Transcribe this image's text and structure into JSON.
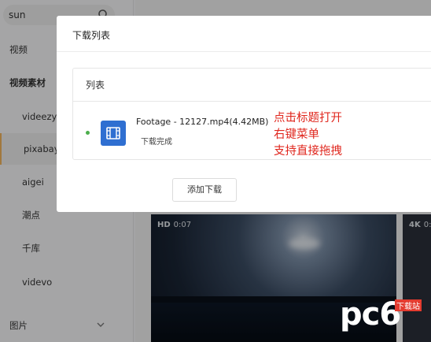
{
  "sidebar": {
    "search_value": "sun",
    "items": [
      {
        "label": "视频"
      },
      {
        "label": "视频素材"
      },
      {
        "label": "videezy"
      },
      {
        "label": "pixabay"
      },
      {
        "label": "aigei"
      },
      {
        "label": "潮点"
      },
      {
        "label": "千库"
      },
      {
        "label": "videvo"
      },
      {
        "label": "图片"
      }
    ]
  },
  "videos": [
    {
      "quality": "HD",
      "duration": "0:07"
    },
    {
      "quality": "4K",
      "duration": "0:0"
    }
  ],
  "dialog": {
    "title": "下载列表",
    "panel_title": "列表",
    "file": {
      "name": "Footage - 12127.mp4(4.42MB)",
      "status": "下载完成"
    },
    "annotation": [
      "点击标题打开",
      "右键菜单",
      "支持直接拖拽"
    ],
    "add_button": "添加下载"
  },
  "watermark": {
    "brand": "pc6",
    "sub": "下载站"
  },
  "colors": {
    "accent": "#2f6fd1",
    "annotation": "#e0271e",
    "status_dot": "#4cae4c",
    "active_marker": "#f0b35c"
  }
}
